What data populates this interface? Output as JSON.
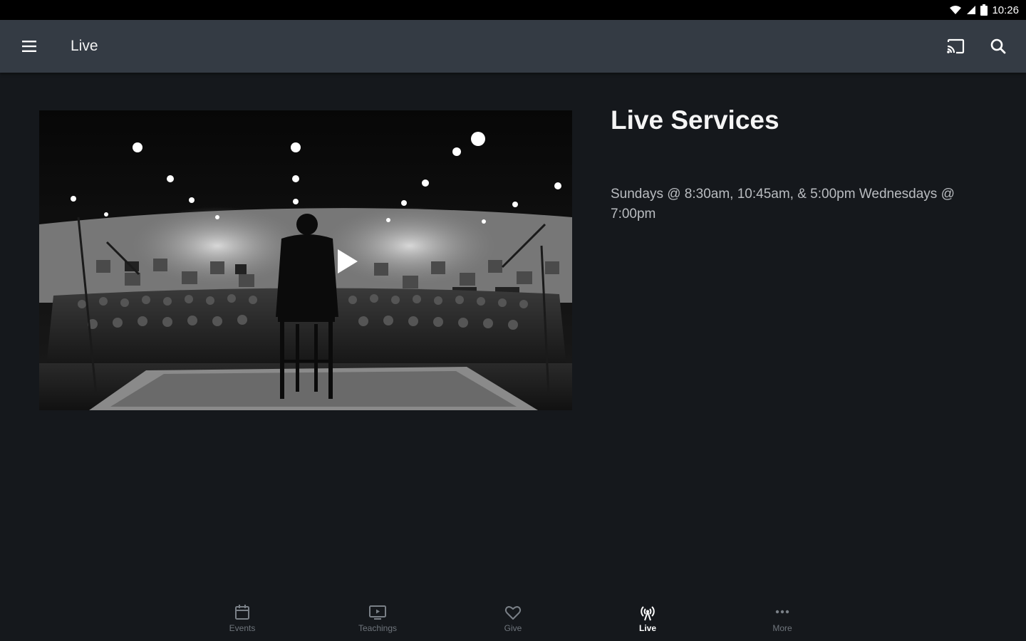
{
  "status_bar": {
    "time": "10:26"
  },
  "app_bar": {
    "title": "Live"
  },
  "content": {
    "heading": "Live Services",
    "schedule": "Sundays @ 8:30am, 10:45am, & 5:00pm  Wednesdays @ 7:00pm"
  },
  "bottom_nav": {
    "items": [
      {
        "label": "Events",
        "icon": "calendar-icon",
        "active": false
      },
      {
        "label": "Teachings",
        "icon": "tv-play-icon",
        "active": false
      },
      {
        "label": "Give",
        "icon": "heart-icon",
        "active": false
      },
      {
        "label": "Live",
        "icon": "broadcast-icon",
        "active": true
      },
      {
        "label": "More",
        "icon": "more-horizontal-icon",
        "active": false
      }
    ]
  },
  "colors": {
    "background": "#15181c",
    "app_bar": "#343b44",
    "inactive_nav": "#6f757c",
    "active_nav": "#ffffff"
  }
}
